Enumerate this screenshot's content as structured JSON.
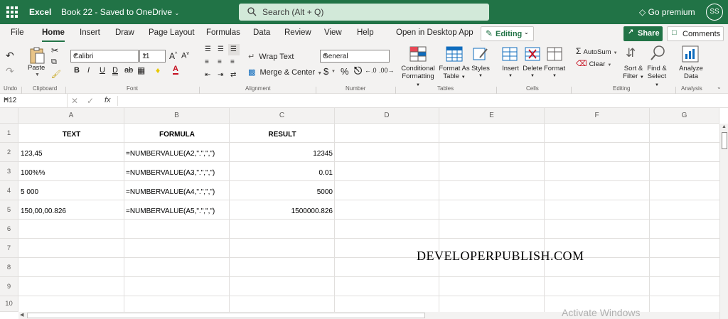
{
  "titlebar": {
    "app_name": "Excel",
    "document": "Book 22 - Saved to OneDrive",
    "search_placeholder": "Search (Alt + Q)",
    "premium": "Go premium",
    "user_initials": "SS"
  },
  "menubar": {
    "tabs": [
      "File",
      "Home",
      "Insert",
      "Draw",
      "Page Layout",
      "Formulas",
      "Data",
      "Review",
      "View",
      "Help",
      "Open in Desktop App"
    ],
    "active_tab": "Home",
    "editing_label": "Editing",
    "share_label": "Share",
    "comments_label": "Comments"
  },
  "ribbon": {
    "undo_group": "Undo",
    "clipboard_group": "Clipboard",
    "paste_label": "Paste",
    "font_group": "Font",
    "font_name": "Calibri",
    "font_size": "11",
    "alignment_group": "Alignment",
    "wrap_text": "Wrap Text",
    "merge_center": "Merge & Center",
    "number_group": "Number",
    "number_format": "General",
    "tables_group": "Tables",
    "conditional_formatting": [
      "Conditional",
      "Formatting"
    ],
    "format_as_table": [
      "Format As",
      "Table"
    ],
    "styles": "Styles",
    "cells_group": "Cells",
    "insert": "Insert",
    "delete": "Delete",
    "format": "Format",
    "editing_group": "Editing",
    "autosum": "AutoSum",
    "clear": "Clear",
    "sort_filter": [
      "Sort &",
      "Filter"
    ],
    "find_select": [
      "Find &",
      "Select"
    ],
    "analysis_group": "Analysis",
    "analyze_data": [
      "Analyze",
      "Data"
    ]
  },
  "formula_bar": {
    "name_box": "H12",
    "fx": "fx",
    "formula": ""
  },
  "sheet": {
    "columns": [
      "A",
      "B",
      "C",
      "D",
      "E",
      "F",
      "G"
    ],
    "rows": [
      "1",
      "2",
      "3",
      "4",
      "5",
      "6",
      "7",
      "8",
      "9",
      "10"
    ],
    "cells": {
      "A1": "TEXT",
      "B1": "FORMULA",
      "C1": "RESULT",
      "A2": "123,45",
      "B2": "=NUMBERVALUE(A2,\".\",\",\")",
      "C2": "12345",
      "A3": "100%%",
      "B3": "=NUMBERVALUE(A3,\".\",\",\")",
      "C3": "0.01",
      "A4": "5 000",
      "B4": "=NUMBERVALUE(A4,\".\",\",\")",
      "C4": "5000",
      "A5": "150,00,00.826",
      "B5": "=NUMBERVALUE(A5,\".\",\",\")",
      "C5": "1500000.826"
    }
  },
  "watermark": "DEVELOPERPUBLISH.COM",
  "activate_windows": "Activate Windows",
  "colors": {
    "brand": "#217346",
    "ribbon_bg": "#f3f2f1",
    "gridline": "#e1dfdd"
  }
}
